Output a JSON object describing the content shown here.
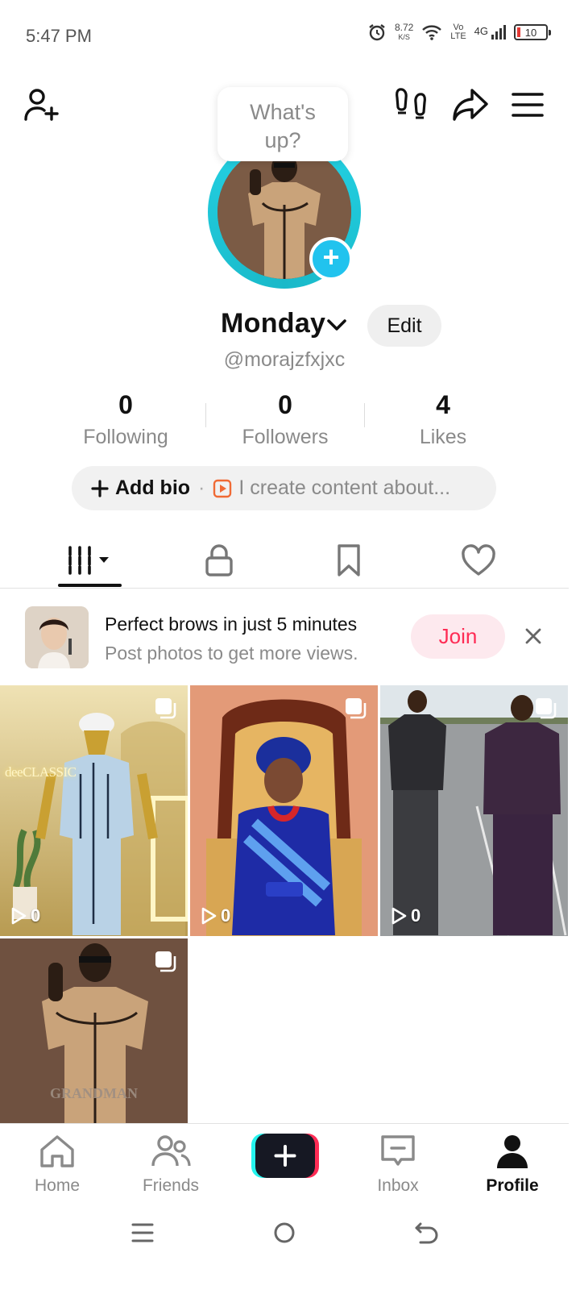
{
  "status_bar": {
    "time": "5:47 PM",
    "net_speed": "8.72",
    "net_unit": "K/S",
    "volte": "Vo\nLTE",
    "signal": "4G",
    "battery": "10"
  },
  "header": {
    "bubble_text": "What's up?"
  },
  "profile": {
    "display_name": "Monday",
    "edit_label": "Edit",
    "username": "@morajzfxjxc",
    "stats": [
      {
        "value": "0",
        "label": "Following"
      },
      {
        "value": "0",
        "label": "Followers"
      },
      {
        "value": "4",
        "label": "Likes"
      }
    ],
    "bio_add": "Add bio",
    "bio_placeholder": "I create content about..."
  },
  "tabs": [
    {
      "icon": "videos-grid-icon",
      "selected": true
    },
    {
      "icon": "lock-icon",
      "selected": false
    },
    {
      "icon": "bookmark-icon",
      "selected": false
    },
    {
      "icon": "heart-icon",
      "selected": false
    }
  ],
  "promo": {
    "title": "Perfect brows in just 5 minutes",
    "subtitle": "Post photos to get more views.",
    "join_label": "Join"
  },
  "posts": [
    {
      "views": "0",
      "watermark": "deeCLASSIC"
    },
    {
      "views": "0"
    },
    {
      "views": "0"
    },
    {
      "views": "",
      "watermark": "GRANDMAN"
    }
  ],
  "bottom_nav": [
    {
      "label": "Home",
      "icon": "home-icon"
    },
    {
      "label": "Friends",
      "icon": "friends-icon"
    },
    {
      "label": "",
      "icon": "plus-icon"
    },
    {
      "label": "Inbox",
      "icon": "inbox-icon"
    },
    {
      "label": "Profile",
      "icon": "profile-icon",
      "active": true
    }
  ],
  "colors": {
    "accent": "#fe2c55",
    "cyan": "#25d4e6",
    "muted": "#8a8a8a"
  }
}
